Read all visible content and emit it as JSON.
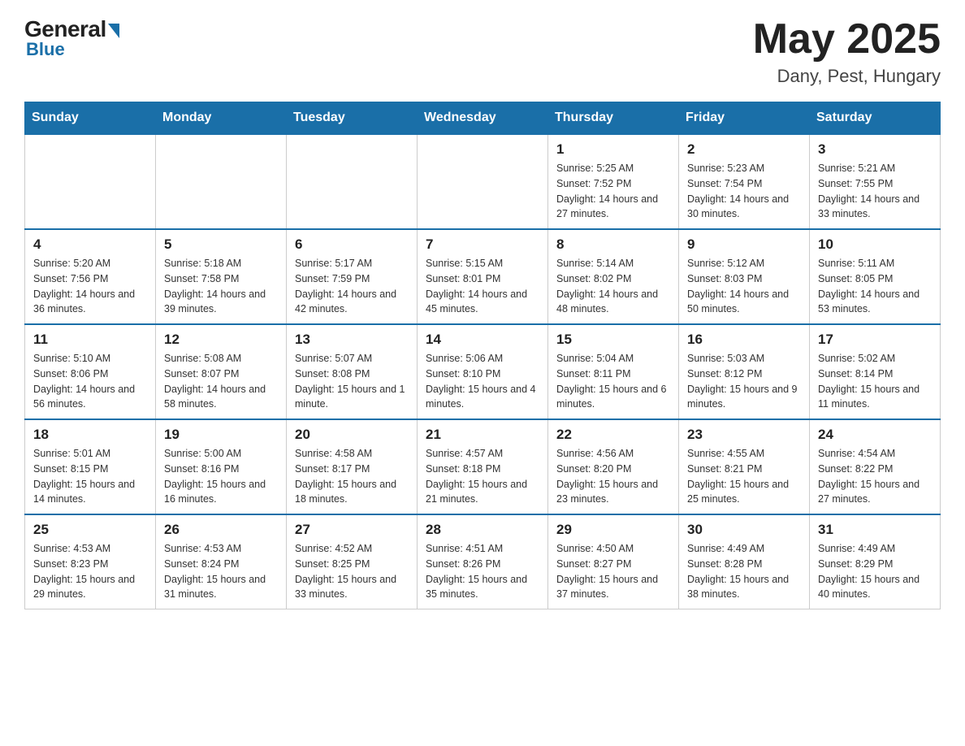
{
  "header": {
    "logo": {
      "general": "General",
      "blue": "Blue"
    },
    "title": "May 2025",
    "location": "Dany, Pest, Hungary"
  },
  "days_of_week": [
    "Sunday",
    "Monday",
    "Tuesday",
    "Wednesday",
    "Thursday",
    "Friday",
    "Saturday"
  ],
  "weeks": [
    [
      {
        "day": "",
        "info": ""
      },
      {
        "day": "",
        "info": ""
      },
      {
        "day": "",
        "info": ""
      },
      {
        "day": "",
        "info": ""
      },
      {
        "day": "1",
        "info": "Sunrise: 5:25 AM\nSunset: 7:52 PM\nDaylight: 14 hours and 27 minutes."
      },
      {
        "day": "2",
        "info": "Sunrise: 5:23 AM\nSunset: 7:54 PM\nDaylight: 14 hours and 30 minutes."
      },
      {
        "day": "3",
        "info": "Sunrise: 5:21 AM\nSunset: 7:55 PM\nDaylight: 14 hours and 33 minutes."
      }
    ],
    [
      {
        "day": "4",
        "info": "Sunrise: 5:20 AM\nSunset: 7:56 PM\nDaylight: 14 hours and 36 minutes."
      },
      {
        "day": "5",
        "info": "Sunrise: 5:18 AM\nSunset: 7:58 PM\nDaylight: 14 hours and 39 minutes."
      },
      {
        "day": "6",
        "info": "Sunrise: 5:17 AM\nSunset: 7:59 PM\nDaylight: 14 hours and 42 minutes."
      },
      {
        "day": "7",
        "info": "Sunrise: 5:15 AM\nSunset: 8:01 PM\nDaylight: 14 hours and 45 minutes."
      },
      {
        "day": "8",
        "info": "Sunrise: 5:14 AM\nSunset: 8:02 PM\nDaylight: 14 hours and 48 minutes."
      },
      {
        "day": "9",
        "info": "Sunrise: 5:12 AM\nSunset: 8:03 PM\nDaylight: 14 hours and 50 minutes."
      },
      {
        "day": "10",
        "info": "Sunrise: 5:11 AM\nSunset: 8:05 PM\nDaylight: 14 hours and 53 minutes."
      }
    ],
    [
      {
        "day": "11",
        "info": "Sunrise: 5:10 AM\nSunset: 8:06 PM\nDaylight: 14 hours and 56 minutes."
      },
      {
        "day": "12",
        "info": "Sunrise: 5:08 AM\nSunset: 8:07 PM\nDaylight: 14 hours and 58 minutes."
      },
      {
        "day": "13",
        "info": "Sunrise: 5:07 AM\nSunset: 8:08 PM\nDaylight: 15 hours and 1 minute."
      },
      {
        "day": "14",
        "info": "Sunrise: 5:06 AM\nSunset: 8:10 PM\nDaylight: 15 hours and 4 minutes."
      },
      {
        "day": "15",
        "info": "Sunrise: 5:04 AM\nSunset: 8:11 PM\nDaylight: 15 hours and 6 minutes."
      },
      {
        "day": "16",
        "info": "Sunrise: 5:03 AM\nSunset: 8:12 PM\nDaylight: 15 hours and 9 minutes."
      },
      {
        "day": "17",
        "info": "Sunrise: 5:02 AM\nSunset: 8:14 PM\nDaylight: 15 hours and 11 minutes."
      }
    ],
    [
      {
        "day": "18",
        "info": "Sunrise: 5:01 AM\nSunset: 8:15 PM\nDaylight: 15 hours and 14 minutes."
      },
      {
        "day": "19",
        "info": "Sunrise: 5:00 AM\nSunset: 8:16 PM\nDaylight: 15 hours and 16 minutes."
      },
      {
        "day": "20",
        "info": "Sunrise: 4:58 AM\nSunset: 8:17 PM\nDaylight: 15 hours and 18 minutes."
      },
      {
        "day": "21",
        "info": "Sunrise: 4:57 AM\nSunset: 8:18 PM\nDaylight: 15 hours and 21 minutes."
      },
      {
        "day": "22",
        "info": "Sunrise: 4:56 AM\nSunset: 8:20 PM\nDaylight: 15 hours and 23 minutes."
      },
      {
        "day": "23",
        "info": "Sunrise: 4:55 AM\nSunset: 8:21 PM\nDaylight: 15 hours and 25 minutes."
      },
      {
        "day": "24",
        "info": "Sunrise: 4:54 AM\nSunset: 8:22 PM\nDaylight: 15 hours and 27 minutes."
      }
    ],
    [
      {
        "day": "25",
        "info": "Sunrise: 4:53 AM\nSunset: 8:23 PM\nDaylight: 15 hours and 29 minutes."
      },
      {
        "day": "26",
        "info": "Sunrise: 4:53 AM\nSunset: 8:24 PM\nDaylight: 15 hours and 31 minutes."
      },
      {
        "day": "27",
        "info": "Sunrise: 4:52 AM\nSunset: 8:25 PM\nDaylight: 15 hours and 33 minutes."
      },
      {
        "day": "28",
        "info": "Sunrise: 4:51 AM\nSunset: 8:26 PM\nDaylight: 15 hours and 35 minutes."
      },
      {
        "day": "29",
        "info": "Sunrise: 4:50 AM\nSunset: 8:27 PM\nDaylight: 15 hours and 37 minutes."
      },
      {
        "day": "30",
        "info": "Sunrise: 4:49 AM\nSunset: 8:28 PM\nDaylight: 15 hours and 38 minutes."
      },
      {
        "day": "31",
        "info": "Sunrise: 4:49 AM\nSunset: 8:29 PM\nDaylight: 15 hours and 40 minutes."
      }
    ]
  ]
}
